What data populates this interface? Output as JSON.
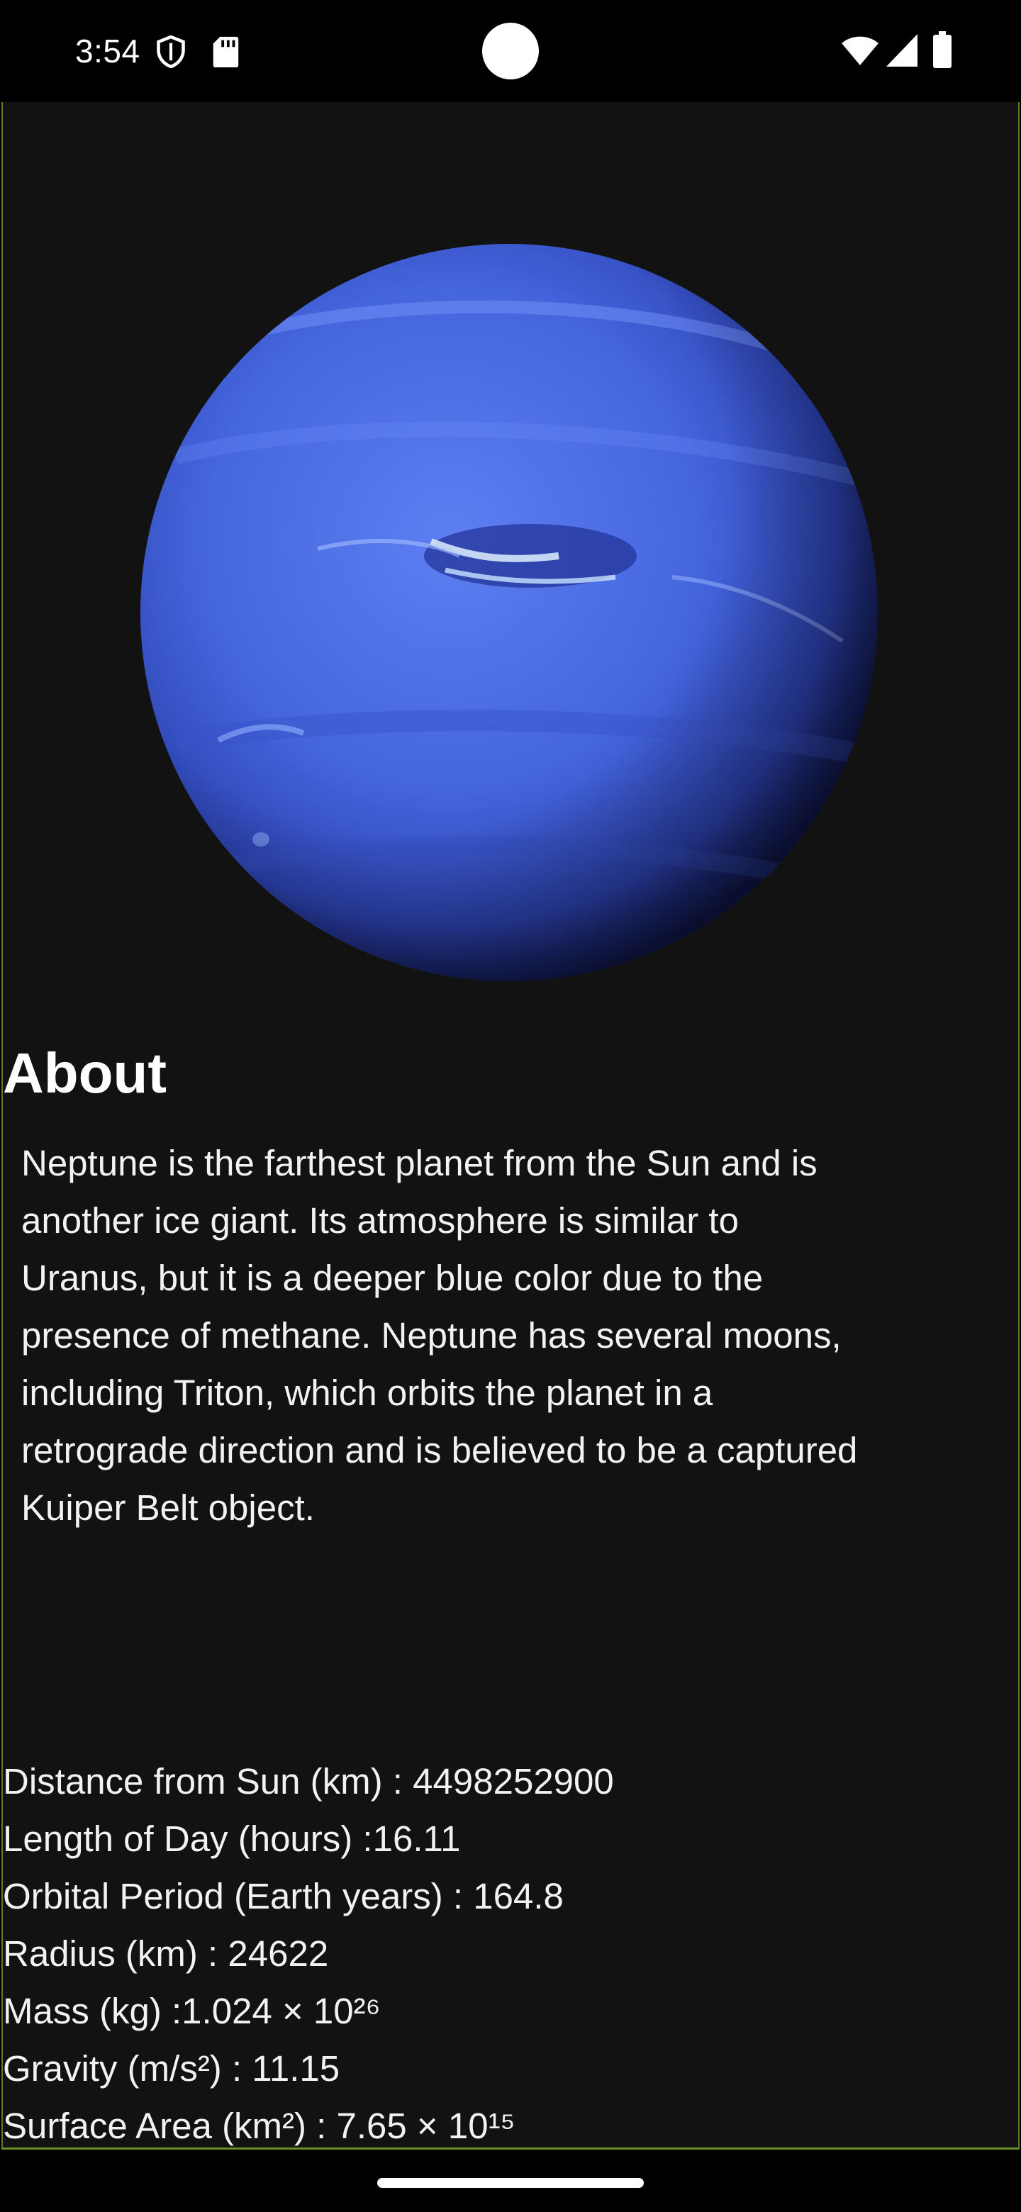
{
  "status_bar": {
    "time": "3:54",
    "icons_left": [
      "shield-icon",
      "sd-card-icon"
    ],
    "icons_right": [
      "wifi-icon",
      "cell-signal-icon",
      "battery-icon"
    ]
  },
  "planet": {
    "image_icon": "neptune-image",
    "colors": {
      "main": "#3f5fd8",
      "light": "#5a7ef0",
      "dark": "#1a2a8a"
    }
  },
  "about": {
    "title": "About",
    "body": "Neptune is the farthest planet from the Sun and is another ice giant. Its atmosphere is similar to Uranus, but it is a deeper blue color due to the presence of methane. Neptune has several moons, including Triton, which orbits the planet in a retrograde direction and is believed to be a captured Kuiper Belt object."
  },
  "facts": [
    "Distance from Sun (km) : 4498252900",
    "Length of Day (hours) :16.11",
    "Orbital Period (Earth years) : 164.8",
    "Radius (km) : 24622",
    "Mass (kg) :1.024 × 10²⁶",
    "Gravity (m/s²) : 11.15",
    "Surface Area (km²) : 7.65 × 10¹⁵"
  ],
  "colors": {
    "background": "#121212",
    "frame_accent": "#6b8f1f",
    "text": "#f2f2f2"
  }
}
